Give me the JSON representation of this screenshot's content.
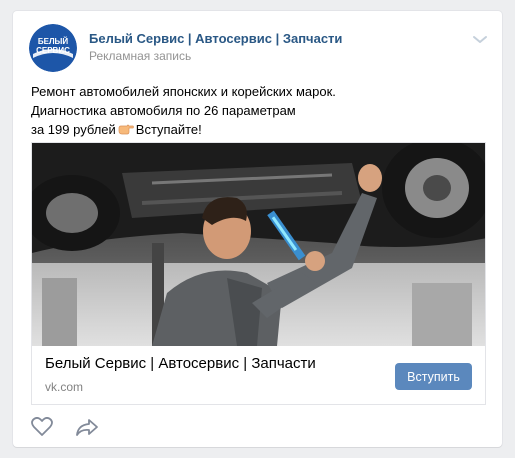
{
  "post": {
    "author": "Белый Сервис | Автосервис | Запчасти",
    "ad_label": "Рекламная запись",
    "avatar_text_line1": "БЕЛЫЙ",
    "avatar_text_line2": "СЕРВИС",
    "text_line1": "Ремонт автомобилей японских и корейских марок.",
    "text_line2": "Диагностика автомобиля по 26 параметрам",
    "text_line3_a": "за 199 рублей",
    "text_line3_b": "Вступайте!",
    "icons": [
      "chevron-down-icon",
      "pointing-hand-icon",
      "like-heart-icon",
      "share-arrow-icon"
    ]
  },
  "snippet": {
    "title": "Белый Сервис | Автосервис | Запчасти",
    "domain": "vk.com",
    "button_label": "Вступить"
  },
  "colors": {
    "link": "#2a5885",
    "button": "#5b88bd",
    "muted": "#939393",
    "page_bg": "#edeef0"
  }
}
